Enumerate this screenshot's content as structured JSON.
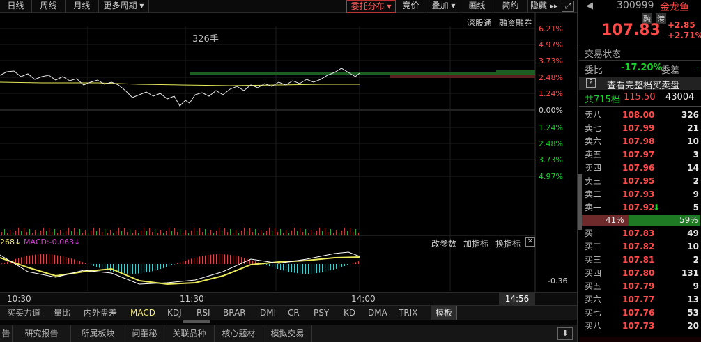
{
  "toolbar": {
    "left": [
      "日线",
      "周线",
      "月线",
      "更多周期 ▾"
    ],
    "right": [
      "委托分布 ▾",
      "竞价",
      "叠加 ▾",
      "画线",
      "简约",
      "隐藏"
    ]
  },
  "chart": {
    "volume_label": "326手",
    "hk_links": [
      "深股通",
      "融资融券"
    ],
    "pct_ticks": [
      {
        "t": "6.21%",
        "c": "#ff4a4a"
      },
      {
        "t": "4.97%",
        "c": "#ff4a4a"
      },
      {
        "t": "3.73%",
        "c": "#ff4a4a"
      },
      {
        "t": "2.48%",
        "c": "#ff4a4a"
      },
      {
        "t": "1.24%",
        "c": "#ff4a4a"
      },
      {
        "t": "0.00%",
        "c": "#d0d0d0"
      },
      {
        "t": "1.24%",
        "c": "#19d02c"
      },
      {
        "t": "2.48%",
        "c": "#19d02c"
      },
      {
        "t": "3.73%",
        "c": "#19d02c"
      },
      {
        "t": "4.97%",
        "c": "#19d02c"
      }
    ],
    "macd_label_left": "268↓",
    "macd_label": "MACD:-0.063↓",
    "indicator_btns": [
      "改参数",
      "加指标",
      "换指标",
      "✕"
    ],
    "macd_axis": "-0.36",
    "time_ticks": [
      "10:30",
      "11:30",
      "14:00"
    ],
    "current_time": "14:56"
  },
  "indicator_tabs": [
    "买卖力道",
    "量比",
    "内外盘差",
    "MACD",
    "KDJ",
    "RSI",
    "BRAR",
    "DMI",
    "CR",
    "PSY",
    "KD",
    "DMA",
    "TRIX",
    "模板"
  ],
  "active_indicator": "MACD",
  "bottom_tabs": [
    "告",
    "研究报告",
    "所属板块",
    "问董秘",
    "关联品种",
    "核心题材",
    "模拟交易"
  ],
  "stock": {
    "code": "300999",
    "name": "金龙鱼",
    "tags": [
      "融",
      "港"
    ],
    "price": "107.83",
    "change": "+2.85",
    "change_pct": "+2.71%"
  },
  "trade_state_label": "交易状态",
  "ratio": {
    "label": "委比",
    "value": "-17.20%",
    "diff_label": "委差",
    "diff_value": "-"
  },
  "full_book_label": "查看完整档买卖盘",
  "full_book_icon": "?",
  "summary": {
    "levels": "共715档",
    "price": "115.50",
    "volume": "43004"
  },
  "sells": [
    {
      "label": "卖八",
      "price": "108.00",
      "vol": "326"
    },
    {
      "label": "卖七",
      "price": "107.99",
      "vol": "21"
    },
    {
      "label": "卖六",
      "price": "107.98",
      "vol": "10"
    },
    {
      "label": "卖五",
      "price": "107.97",
      "vol": "3"
    },
    {
      "label": "卖四",
      "price": "107.96",
      "vol": "14"
    },
    {
      "label": "卖三",
      "price": "107.95",
      "vol": "2"
    },
    {
      "label": "卖二",
      "price": "107.93",
      "vol": "9"
    },
    {
      "label": "卖一",
      "price": "107.92",
      "vol": "5",
      "arrow": "⬇"
    }
  ],
  "bar": {
    "left": "41%",
    "right": "59%",
    "left_frac": 0.41
  },
  "buys": [
    {
      "label": "买一",
      "price": "107.83",
      "vol": "49"
    },
    {
      "label": "买二",
      "price": "107.82",
      "vol": "10"
    },
    {
      "label": "买三",
      "price": "107.81",
      "vol": "2"
    },
    {
      "label": "买四",
      "price": "107.80",
      "vol": "131"
    },
    {
      "label": "买五",
      "price": "107.79",
      "vol": "9"
    },
    {
      "label": "买六",
      "price": "107.77",
      "vol": "13"
    },
    {
      "label": "买七",
      "price": "107.76",
      "vol": "53"
    },
    {
      "label": "买八",
      "price": "107.73",
      "vol": "20"
    }
  ],
  "colors": {
    "up": "#ff4a4a",
    "down": "#19d02c",
    "avg": "#e8e85a",
    "accent": "#ff5c5c"
  }
}
